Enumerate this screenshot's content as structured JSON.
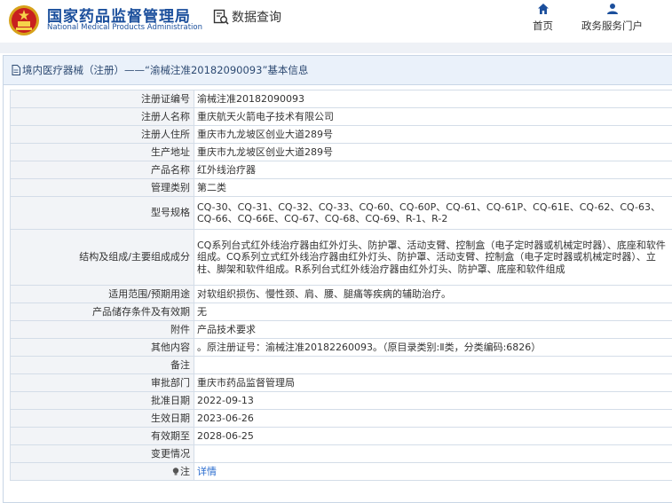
{
  "header": {
    "org_cn": "国家药品监督管理局",
    "org_en": "National Medical Products Administration",
    "query_label": "数据查询",
    "nav": [
      {
        "label": "首页",
        "icon": "home-icon"
      },
      {
        "label": "政务服务门户",
        "icon": "user-icon"
      }
    ]
  },
  "panel": {
    "title": "境内医疗器械（注册）——“渝械注准20182090093”基本信息"
  },
  "rows": [
    {
      "label": "注册证编号",
      "value": "渝械注准20182090093"
    },
    {
      "label": "注册人名称",
      "value": "重庆航天火箭电子技术有限公司"
    },
    {
      "label": "注册人住所",
      "value": "重庆市九龙坡区创业大道289号"
    },
    {
      "label": "生产地址",
      "value": "重庆市九龙坡区创业大道289号"
    },
    {
      "label": "产品名称",
      "value": "红外线治疗器"
    },
    {
      "label": "管理类别",
      "value": "第二类"
    },
    {
      "label": "型号规格",
      "value": "CQ-30、CQ-31、CQ-32、CQ-33、CQ-60、CQ-60P、CQ-61、CQ-61P、CQ-61E、CQ-62、CQ-63、CQ-66、CQ-66E、CQ-67、CQ-68、CQ-69、R-1、R-2"
    },
    {
      "label": "结构及组成/主要组成成分",
      "value": "CQ系列台式红外线治疗器由红外灯头、防护罩、活动支臂、控制盒（电子定时器或机械定时器）、底座和软件组成。CQ系列立式红外线治疗器由红外灯头、防护罩、活动支臂、控制盒（电子定时器或机械定时器）、立柱、脚架和软件组成。R系列台式红外线治疗器由红外灯头、防护罩、底座和软件组成"
    },
    {
      "label": "适用范围/预期用途",
      "value": "对软组织损伤、慢性颈、肩、腰、腿痛等疾病的辅助治疗。"
    },
    {
      "label": "产品储存条件及有效期",
      "value": "无"
    },
    {
      "label": "附件",
      "value": "产品技术要求"
    },
    {
      "label": "其他内容",
      "value": "。原注册证号：渝械注准20182260093。（原目录类别:Ⅱ类，分类编码:6826）"
    },
    {
      "label": "备注",
      "value": ""
    },
    {
      "label": "审批部门",
      "value": "重庆市药品监督管理局"
    },
    {
      "label": "批准日期",
      "value": "2022-09-13"
    },
    {
      "label": "生效日期",
      "value": "2023-06-26"
    },
    {
      "label": "有效期至",
      "value": "2028-06-25"
    },
    {
      "label": "变更情况",
      "value": ""
    },
    {
      "label": "注",
      "value": "详情",
      "icon": "lightbulb-icon"
    }
  ],
  "colors": {
    "brand": "#1b4f9c",
    "link": "#2a6ccf",
    "label_bg": "#f2f4f7",
    "head_bg": "#eaf1fa"
  }
}
